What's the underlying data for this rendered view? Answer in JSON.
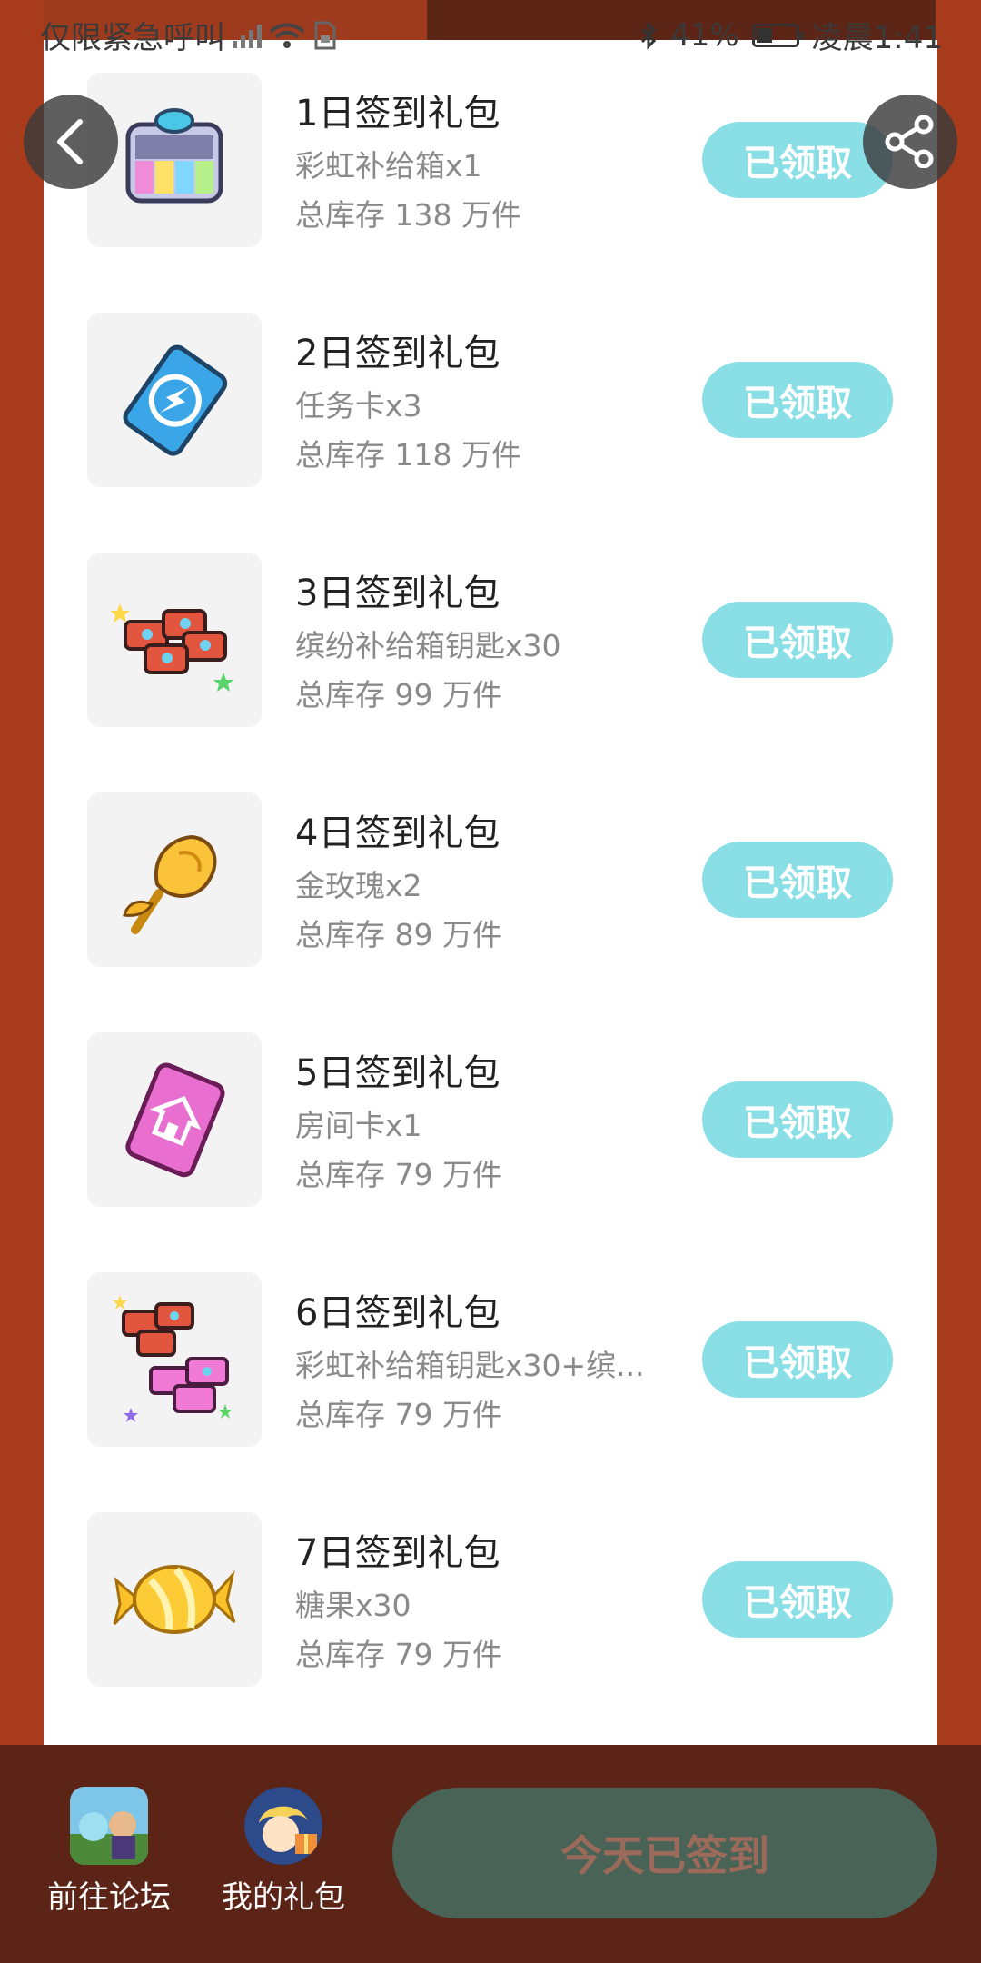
{
  "status_bar": {
    "carrier": "仅限紧急呼叫",
    "battery": "41%",
    "battery_level": 0.41,
    "time": "凌晨1:41"
  },
  "top_actions": {
    "back_icon": "chevron-left-icon",
    "share_icon": "share-icon"
  },
  "gifts": [
    {
      "title": "1日签到礼包",
      "desc": "彩虹补给箱x1",
      "stock": "总库存 138 万件",
      "button": "已领取",
      "icon": "rainbow-crate-icon"
    },
    {
      "title": "2日签到礼包",
      "desc": "任务卡x3",
      "stock": "总库存 118 万件",
      "button": "已领取",
      "icon": "task-card-icon"
    },
    {
      "title": "3日签到礼包",
      "desc": "缤纷补给箱钥匙x30",
      "stock": "总库存 99 万件",
      "button": "已领取",
      "icon": "keys-icon"
    },
    {
      "title": "4日签到礼包",
      "desc": "金玫瑰x2",
      "stock": "总库存 89 万件",
      "button": "已领取",
      "icon": "gold-rose-icon"
    },
    {
      "title": "5日签到礼包",
      "desc": "房间卡x1",
      "stock": "总库存 79 万件",
      "button": "已领取",
      "icon": "room-card-icon"
    },
    {
      "title": "6日签到礼包",
      "desc": "彩虹补给箱钥匙x30+缤...",
      "stock": "总库存 79 万件",
      "button": "已领取",
      "icon": "key-bundle-icon"
    },
    {
      "title": "7日签到礼包",
      "desc": "糖果x30",
      "stock": "总库存 79 万件",
      "button": "已领取",
      "icon": "candy-icon"
    }
  ],
  "bottom_bar": {
    "forum_label": "前往论坛",
    "my_gifts_label": "我的礼包",
    "checkin_label": "今天已签到"
  },
  "colors": {
    "frame": "#a33b1d",
    "bottom_bar": "#5b2416",
    "claimed_button": "#8adfe6",
    "checkin_button": "#4a6357"
  }
}
